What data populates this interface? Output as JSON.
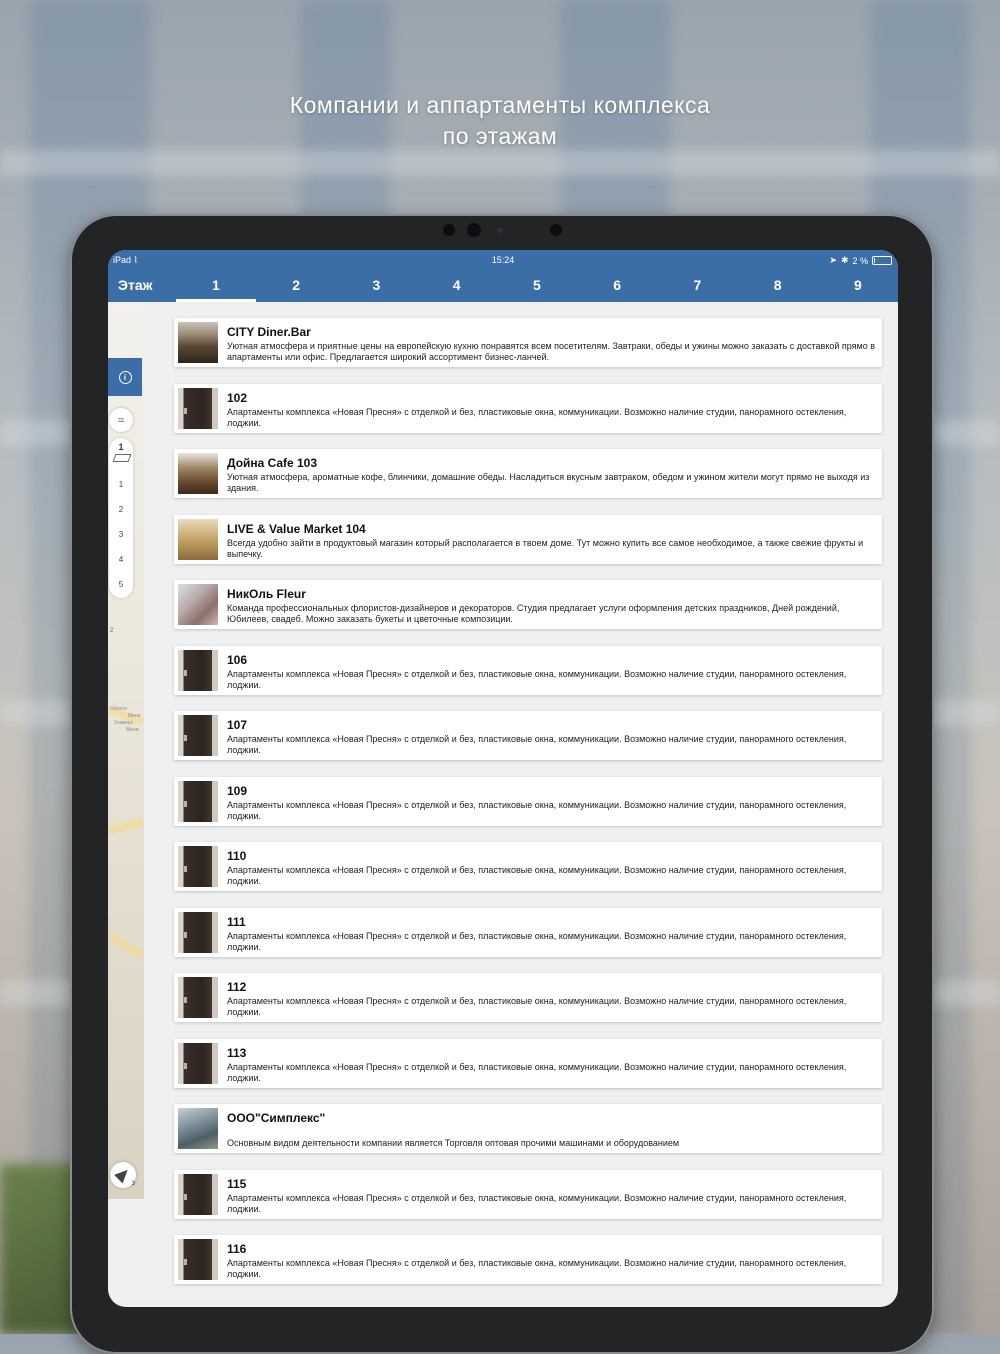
{
  "headline": {
    "line1": "Компании и аппартаменты комплекса",
    "line2": "по этажам"
  },
  "status_bar": {
    "device": "iPad",
    "time": "15:24",
    "battery": "2 %",
    "icons": [
      "wifi-icon",
      "location-arrow-icon",
      "bluetooth-icon",
      "battery-icon"
    ]
  },
  "floor_tabs": {
    "label": "Этаж",
    "tabs": [
      "1",
      "2",
      "3",
      "4",
      "5",
      "6",
      "7",
      "8",
      "9"
    ],
    "active": "1"
  },
  "colors": {
    "accent": "#3b6ea6",
    "card_bg": "#ffffff",
    "list_bg": "#f0f0f0"
  },
  "map_panel": {
    "current_floor": "1",
    "floors": [
      "1",
      "2",
      "3",
      "4",
      "5"
    ],
    "map_label_number": "2",
    "map_poi": [
      "Univers",
      "Мени",
      "Универс",
      "Мени"
    ],
    "locate_badge": "3"
  },
  "items": [
    {
      "title": "CITY Diner.Bar",
      "desc": "Уютная атмосфера и приятные цены на европейскую кухню понравятся всем посетителям. Завтраки, обеды и ужины можно заказать с доставкой прямо в апартаменты или офис. Предлагается широкий ассортимент бизнес-ланчей.",
      "thumb": "cafe1"
    },
    {
      "title": "102",
      "desc": "Апартаменты комплекса «Новая Пресня» с отделкой и без, пластиковые окна, коммуникации. Возможно наличие студии, панорамного остекления, лоджии.",
      "thumb": "door"
    },
    {
      "title": "Дойна Cafe 103",
      "desc": "Уютная атмосфера, ароматные кофе, блинчики, домашние обеды. Насладиться вкусным завтраком, обедом и ужином жители могут прямо не выходя из здания.",
      "thumb": "cafe2"
    },
    {
      "title": "LIVE & Value Market 104",
      "desc": "Всегда удобно зайти в продуктовый магазин который располагается в твоем доме. Тут можно купить все самое необходимое, а также свежие фрукты и выпечку.",
      "thumb": "market"
    },
    {
      "title": "НикОль Fleur",
      "desc": "Команда профессиональных флористов-дизайнеров и декораторов. Студия предлагает услуги оформления детских праздников, Дней рождений, Юбилеев, свадеб. Можно заказать букеты и цветочные композиции.",
      "thumb": "flowers"
    },
    {
      "title": "106",
      "desc": "Апартаменты комплекса «Новая Пресня» с отделкой и без, пластиковые окна, коммуникации. Возможно наличие студии, панорамного остекления, лоджии.",
      "thumb": "door"
    },
    {
      "title": "107",
      "desc": "Апартаменты комплекса «Новая Пресня» с отделкой и без, пластиковые окна, коммуникации. Возможно наличие студии, панорамного остекления, лоджии.",
      "thumb": "door"
    },
    {
      "title": "109",
      "desc": "Апартаменты комплекса «Новая Пресня» с отделкой и без, пластиковые окна, коммуникации. Возможно наличие студии, панорамного остекления, лоджии.",
      "thumb": "door"
    },
    {
      "title": "110",
      "desc": "Апартаменты комплекса «Новая Пресня» с отделкой и без, пластиковые окна, коммуникации. Возможно наличие студии, панорамного остекления, лоджии.",
      "thumb": "door"
    },
    {
      "title": "111",
      "desc": "Апартаменты комплекса «Новая Пресня» с отделкой и без, пластиковые окна, коммуникации. Возможно наличие студии, панорамного остекления, лоджии.",
      "thumb": "door"
    },
    {
      "title": "112",
      "desc": "Апартаменты комплекса «Новая Пресня» с отделкой и без, пластиковые окна, коммуникации. Возможно наличие студии, панорамного остекления, лоджии.",
      "thumb": "door"
    },
    {
      "title": "113",
      "desc": "Апартаменты комплекса «Новая Пресня» с отделкой и без, пластиковые окна, коммуникации. Возможно наличие студии, панорамного остекления, лоджии.",
      "thumb": "door"
    },
    {
      "title": "ООО\"Симплекс\"",
      "desc": "Основным видом деятельности компании является Торговля оптовая прочими машинами и оборудованием",
      "thumb": "building",
      "tall": true
    },
    {
      "title": "115",
      "desc": "Апартаменты комплекса «Новая Пресня» с отделкой и без, пластиковые окна, коммуникации. Возможно наличие студии, панорамного остекления, лоджии.",
      "thumb": "door"
    },
    {
      "title": "116",
      "desc": "Апартаменты комплекса «Новая Пресня» с отделкой и без, пластиковые окна, коммуникации. Возможно наличие студии, панорамного остекления, лоджии.",
      "thumb": "door"
    }
  ]
}
